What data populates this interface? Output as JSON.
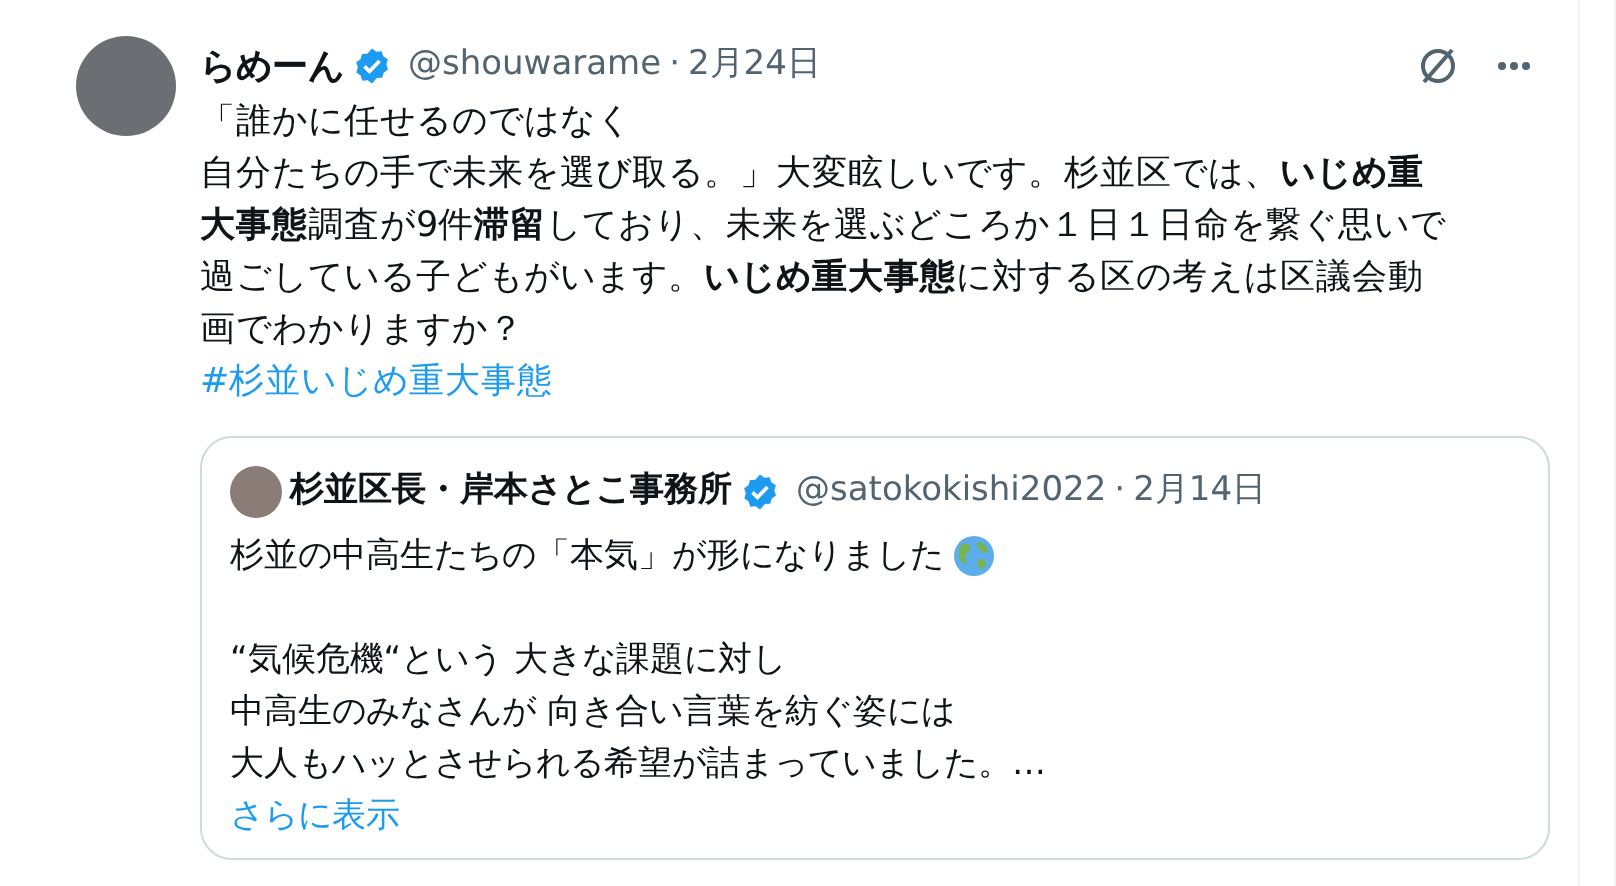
{
  "post": {
    "author": "らめーん",
    "verified": true,
    "handle": "@shouwarame",
    "separator": "·",
    "date": "2月24日",
    "body_lines": [
      "「誰かに任せるのではなく",
      "自分たちの手で未来を選び取る。」大変眩しいです。杉並区では、**いじめ重**",
      "**大事態**調査が9件**滞留**しており、未来を選ぶどころか１日１日命を繋ぐ思いで",
      "過ごしている子どもがいます。**いじめ重大事態**に対する区の考えは区議会動",
      "画でわかりますか？"
    ],
    "hashtag": "#杉並いじめ重大事態",
    "quoted": {
      "author": "杉並区長・岸本さとこ事務所",
      "verified": true,
      "handle": "@satokokishi2022",
      "separator": "·",
      "date": "2月14日",
      "paragraphs": [
        [
          "杉並の中高生たちの「本気」が形になりました"
        ],
        [
          "“気候危機“という 大きな課題に対し",
          "中高生のみなさんが 向き合い言葉を紡ぐ姿には",
          "大人もハッとさせられる希望が詰まっていました。…"
        ]
      ],
      "show_more": "さらに表示"
    }
  }
}
